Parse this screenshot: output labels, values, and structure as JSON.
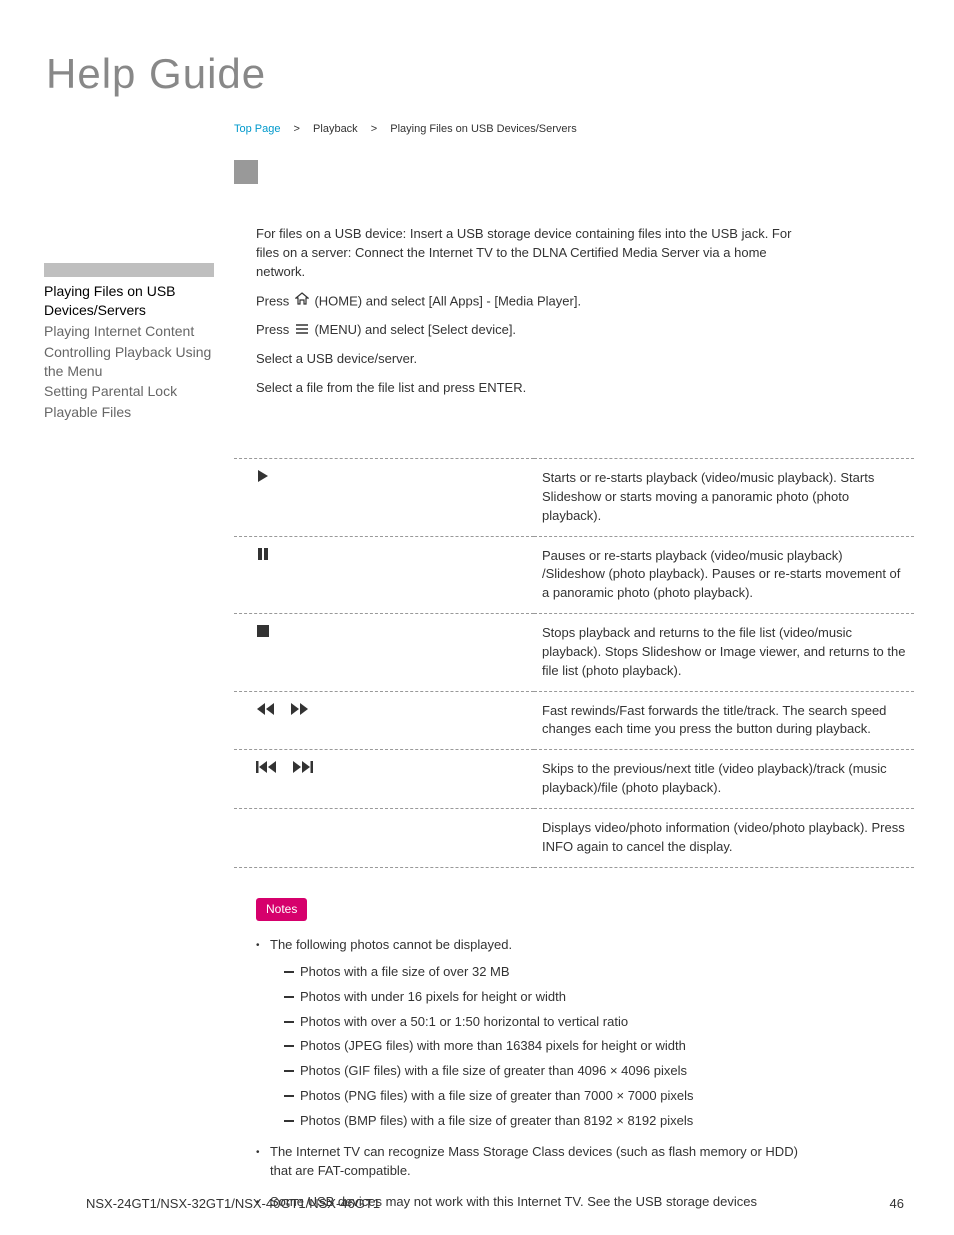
{
  "header": {
    "title": "Help Guide"
  },
  "breadcrumb": {
    "top": "Top Page",
    "mid": "Playback",
    "current": "Playing Files on USB Devices/Servers"
  },
  "sidebar": {
    "items": [
      "Playing Files on USB Devices/Servers",
      "Playing Internet Content",
      "Controlling Playback Using the Menu",
      "Setting Parental Lock",
      "Playable Files"
    ]
  },
  "intro": "For files on a USB device: Insert a USB storage device containing files into the USB jack. For files on a server: Connect the Internet TV to the DLNA Certified Media Server via a home network.",
  "steps": {
    "s1a": "Press ",
    "s1b": "(HOME) and select [All Apps] - [Media Player].",
    "s2a": "Press ",
    "s2b": "(MENU) and select [Select device].",
    "s3": "Select a USB device/server.",
    "s4": "Select a file from the file list and press ENTER."
  },
  "controls": [
    {
      "icon": "play",
      "desc": "Starts or re-starts playback (video/music playback). Starts Slideshow or starts moving a panoramic photo (photo playback)."
    },
    {
      "icon": "pause",
      "desc": "Pauses or re-starts playback (video/music playback) /Slideshow (photo playback). Pauses or re-starts movement of a panoramic photo (photo playback)."
    },
    {
      "icon": "stop",
      "desc": "Stops playback and returns to the file list (video/music playback). Stops Slideshow or Image viewer, and returns to the file list (photo playback)."
    },
    {
      "icon": "rewff",
      "desc": "Fast rewinds/Fast forwards the title/track. The search speed changes each time you press the button during playback."
    },
    {
      "icon": "skip",
      "desc": "Skips to the previous/next title (video playback)/track (music playback)/file (photo playback)."
    },
    {
      "icon": "",
      "desc": "Displays video/photo information (video/photo playback). Press INFO again to cancel the display."
    }
  ],
  "notes": {
    "label": "Notes",
    "items": [
      {
        "text": "The following photos cannot be displayed.",
        "sub": [
          "Photos with a file size of over 32 MB",
          "Photos with under 16 pixels for height or width",
          "Photos with over a 50:1 or 1:50 horizontal to vertical ratio",
          "Photos (JPEG files) with more than 16384 pixels for height or width",
          "Photos (GIF files) with a file size of greater than 4096 × 4096 pixels",
          "Photos (PNG files) with a file size of greater than 7000 × 7000 pixels",
          "Photos (BMP files) with a file size of greater than 8192 × 8192 pixels"
        ]
      },
      {
        "text": "The Internet TV can recognize Mass Storage Class devices (such as flash memory or HDD) that are FAT-compatible."
      },
      {
        "text": "Some USB devices may not work with this Internet TV. See the USB storage devices"
      }
    ]
  },
  "footer": {
    "model": "NSX-24GT1/NSX-32GT1/NSX-40GT1/NSX-46GT1",
    "page": "46"
  }
}
